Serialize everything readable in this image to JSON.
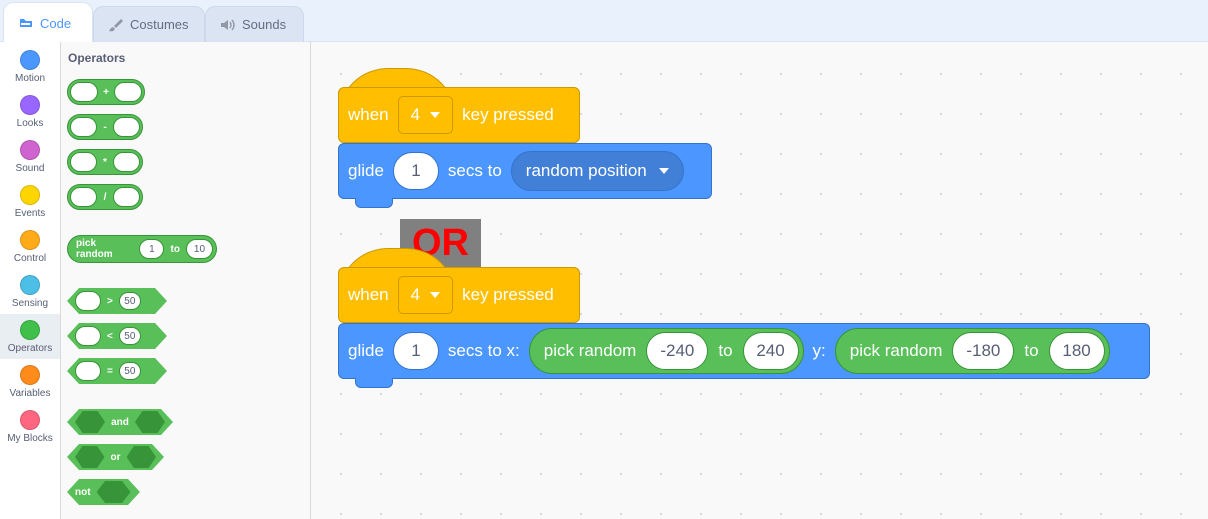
{
  "tabs": [
    {
      "label": "Code",
      "icon": "code-icon"
    },
    {
      "label": "Costumes",
      "icon": "paintbrush-icon"
    },
    {
      "label": "Sounds",
      "icon": "speaker-icon"
    }
  ],
  "categories": [
    {
      "label": "Motion",
      "color": "#4c97ff"
    },
    {
      "label": "Looks",
      "color": "#9966ff"
    },
    {
      "label": "Sound",
      "color": "#cf63cf"
    },
    {
      "label": "Events",
      "color": "#ffd500"
    },
    {
      "label": "Control",
      "color": "#ffab19"
    },
    {
      "label": "Sensing",
      "color": "#4cbfe6"
    },
    {
      "label": "Operators",
      "color": "#40bf4a"
    },
    {
      "label": "Variables",
      "color": "#ff8c1a"
    },
    {
      "label": "My Blocks",
      "color": "#ff6680"
    }
  ],
  "flyout": {
    "title": "Operators",
    "arith": [
      "+",
      "-",
      "*",
      "/"
    ],
    "pick_random": {
      "label": "pick random",
      "from": "1",
      "to_label": "to",
      "to": "10"
    },
    "compare": [
      {
        "op": ">",
        "value": "50"
      },
      {
        "op": "<",
        "value": "50"
      },
      {
        "op": "=",
        "value": "50"
      }
    ],
    "logic": {
      "and": "and",
      "or": "or",
      "not": "not"
    }
  },
  "script1": {
    "hat_when": "when",
    "key": "4",
    "hat_tail": "key pressed",
    "glide": "glide",
    "secs": "1",
    "secs_to": "secs to",
    "target": "random position"
  },
  "separator": "OR",
  "script2": {
    "hat_when": "when",
    "key": "4",
    "hat_tail": "key pressed",
    "glide": "glide",
    "secs": "1",
    "secs_to_x": "secs to x:",
    "pick_random": "pick random",
    "x_from": "-240",
    "to": "to",
    "x_to": "240",
    "y_label": "y:",
    "y_from": "-180",
    "y_to": "180"
  }
}
